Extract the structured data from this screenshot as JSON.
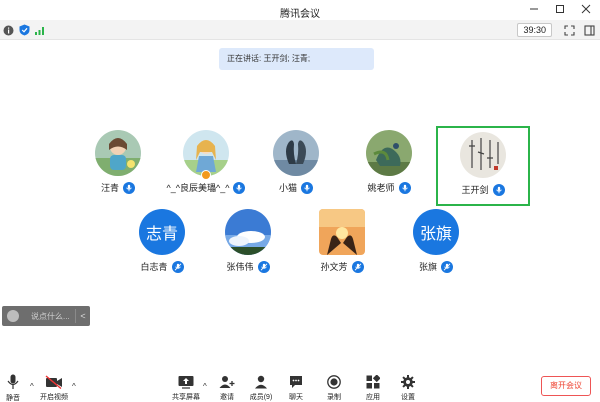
{
  "window": {
    "title": "腾讯会议"
  },
  "toolbar": {
    "timer": "39:30"
  },
  "speaking": {
    "text": "正在讲话: 王开剑; 汪青;"
  },
  "participants": [
    {
      "name": "汪青",
      "avatar": "photo-girl-cartoon"
    },
    {
      "name": "^_^良辰美瓃^_^",
      "avatar": "photo-cartoon-girl",
      "host": true
    },
    {
      "name": "小猫",
      "avatar": "photo-swans"
    },
    {
      "name": "姚老师",
      "avatar": "photo-peacock"
    },
    {
      "name": "王开剑",
      "avatar": "photo-calligraphy",
      "selected": true
    },
    {
      "name": "白志青",
      "avatar_text": "志青"
    },
    {
      "name": "张伟伟",
      "avatar": "photo-sky"
    },
    {
      "name": "孙文芳",
      "avatar": "photo-sunset-heart"
    },
    {
      "name": "张旗",
      "avatar_text": "张旗"
    }
  ],
  "chat": {
    "placeholder": "说点什么..."
  },
  "bottom": {
    "mute": "静音",
    "video": "开启视频",
    "share": "共享屏幕",
    "invite": "邀请",
    "members": "成员(9)",
    "chat": "聊天",
    "record": "录制",
    "apps": "应用",
    "settings": "设置",
    "leave": "离开会议"
  },
  "colors": {
    "accent": "#1a77e0",
    "selected_border": "#2bb44a",
    "leave": "#e43333"
  }
}
